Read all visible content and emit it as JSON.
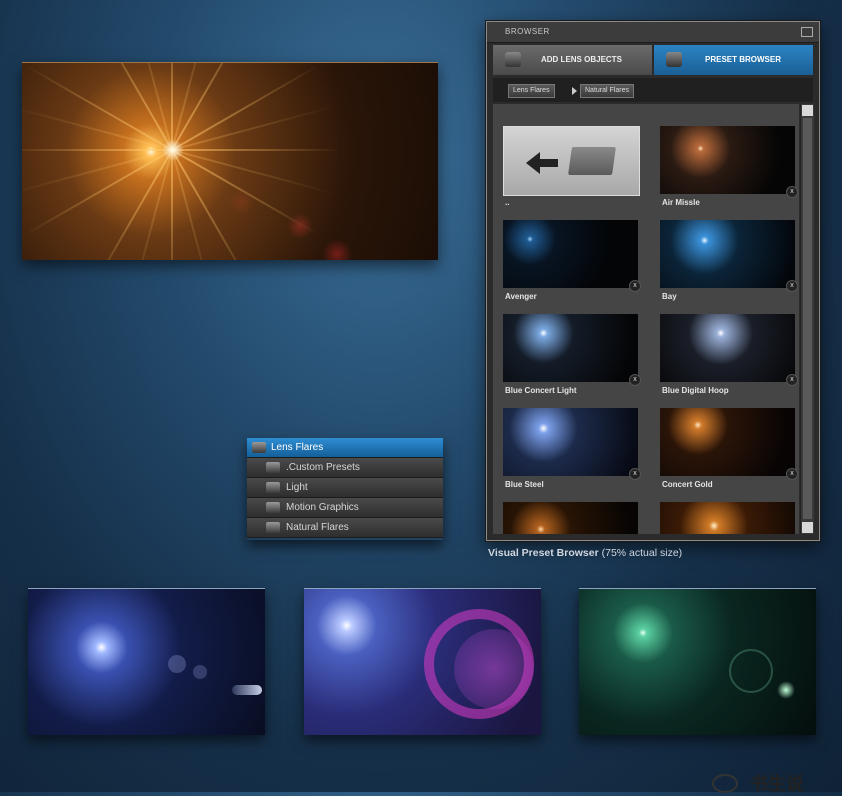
{
  "browser": {
    "title": "BROWSER",
    "tabs": [
      {
        "label": "ADD LENS OBJECTS",
        "active": false
      },
      {
        "label": "PRESET BROWSER",
        "active": true
      }
    ],
    "breadcrumb": [
      "Lens Flares",
      "Natural Flares"
    ],
    "presets": [
      {
        "label": "..",
        "kind": "folder-up"
      },
      {
        "label": "Air Missle",
        "color": "#f2c8a0"
      },
      {
        "label": "Avenger",
        "color": "#4aa0e8"
      },
      {
        "label": "Bay",
        "color": "#6fb8ff"
      },
      {
        "label": "Blue Concert Light",
        "color": "#9cc8ff"
      },
      {
        "label": "Blue Digital Hoop",
        "color": "#c8d8ff"
      },
      {
        "label": "Blue Steel",
        "color": "#a8c4ff"
      },
      {
        "label": "Concert Gold",
        "color": "#ffb060"
      },
      {
        "label": "",
        "color": "#ff9a40"
      },
      {
        "label": "",
        "color": "#ffa850"
      }
    ],
    "close_glyph": "x"
  },
  "tree": {
    "items": [
      {
        "label": "Lens Flares",
        "selected": true,
        "level": 0
      },
      {
        "label": ".Custom Presets",
        "selected": false,
        "level": 1
      },
      {
        "label": "Light",
        "selected": false,
        "level": 1
      },
      {
        "label": "Motion Graphics",
        "selected": false,
        "level": 1
      },
      {
        "label": "Natural Flares",
        "selected": false,
        "level": 1
      }
    ]
  },
  "caption": {
    "bold": "Visual Preset Browser",
    "rest": " (75% actual size)"
  },
  "watermark": "书生说",
  "colors": {
    "accent": "#1e6fae",
    "panel": "#2b2b2b",
    "tile_bg": "#454545"
  }
}
